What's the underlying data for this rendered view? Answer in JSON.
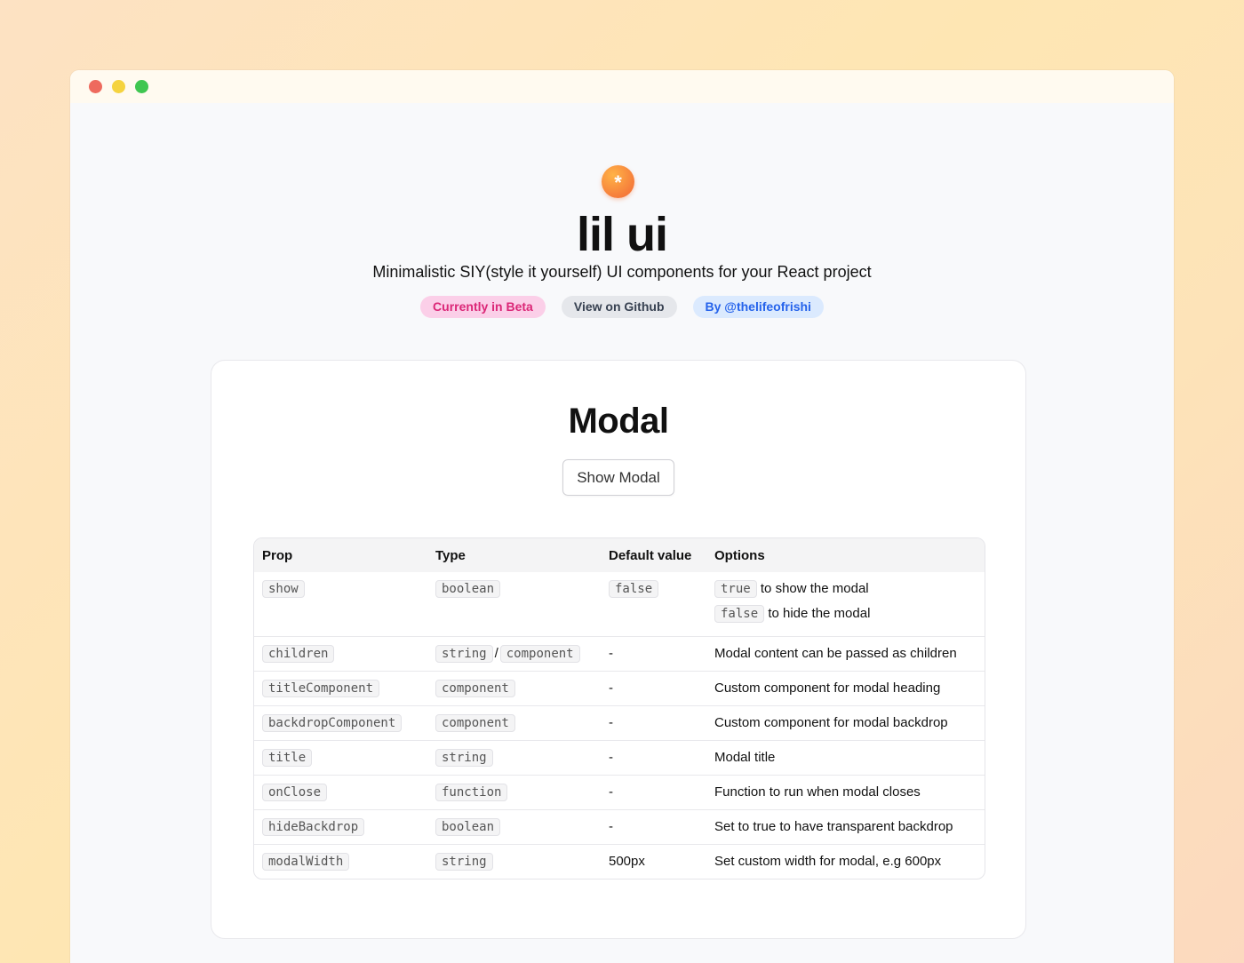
{
  "window": {
    "controls": {
      "close_color": "#ee6a5e",
      "minimize_color": "#f5d33f",
      "maximize_color": "#3fc651"
    }
  },
  "hero": {
    "logo_glyph": "*",
    "brand": "lil ui",
    "tagline": "Minimalistic SIY(style it yourself) UI components for your React project",
    "badges": [
      {
        "label": "Currently in Beta"
      },
      {
        "label": "View on Github"
      },
      {
        "label": "By @thelifeofrishi"
      }
    ]
  },
  "card": {
    "title": "Modal",
    "show_button_label": "Show Modal",
    "table": {
      "headers": [
        "Prop",
        "Type",
        "Default value",
        "Options"
      ],
      "rows": [
        {
          "prop": "show",
          "types": [
            "boolean"
          ],
          "default": "false",
          "default_is_code": true,
          "options": [
            {
              "code": "true",
              "text": "to show the modal"
            },
            {
              "code": "false",
              "text": "to hide the modal"
            }
          ]
        },
        {
          "prop": "children",
          "types": [
            "string",
            "component"
          ],
          "type_separator": "/",
          "default": "-",
          "options_text": "Modal content can be passed as children"
        },
        {
          "prop": "titleComponent",
          "types": [
            "component"
          ],
          "default": "-",
          "options_text": "Custom component for modal heading"
        },
        {
          "prop": "backdropComponent",
          "types": [
            "component"
          ],
          "default": "-",
          "options_text": "Custom component for modal backdrop"
        },
        {
          "prop": "title",
          "types": [
            "string"
          ],
          "default": "-",
          "options_text": "Modal title"
        },
        {
          "prop": "onClose",
          "types": [
            "function"
          ],
          "default": "-",
          "options_text": "Function to run when modal closes"
        },
        {
          "prop": "hideBackdrop",
          "types": [
            "boolean"
          ],
          "default": "-",
          "options_text": "Set to true to have transparent backdrop"
        },
        {
          "prop": "modalWidth",
          "types": [
            "string"
          ],
          "default": "500px",
          "options_text": "Set custom width for modal, e.g 600px"
        }
      ]
    }
  }
}
